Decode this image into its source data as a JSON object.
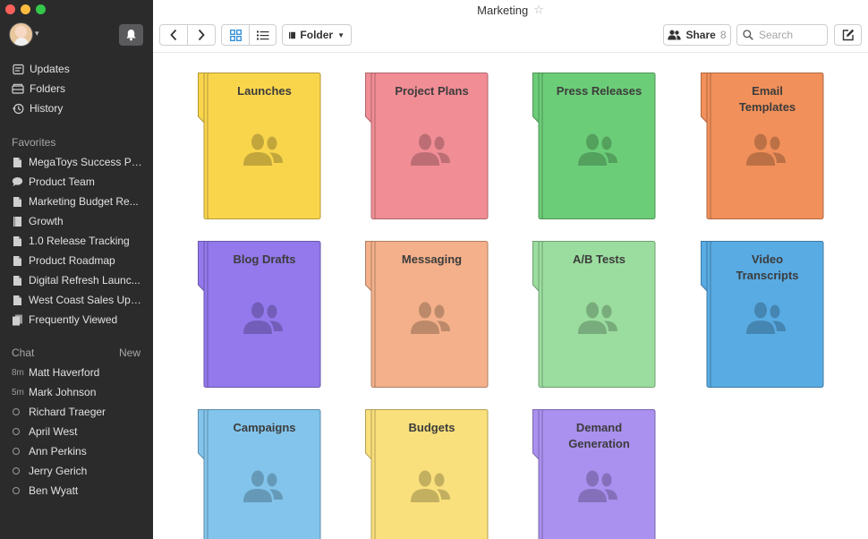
{
  "window": {
    "title": "Marketing"
  },
  "sidebar": {
    "nav": [
      {
        "label": "Updates",
        "icon": "updates-icon"
      },
      {
        "label": "Folders",
        "icon": "folders-icon"
      },
      {
        "label": "History",
        "icon": "history-icon"
      }
    ],
    "favorites_title": "Favorites",
    "favorites": [
      {
        "label": "MegaToys Success Plan",
        "icon": "document-icon"
      },
      {
        "label": "Product Team",
        "icon": "chat-bubble-icon"
      },
      {
        "label": "Marketing Budget Re...",
        "icon": "document-icon"
      },
      {
        "label": "Growth",
        "icon": "folder-icon"
      },
      {
        "label": "1.0 Release Tracking",
        "icon": "document-icon"
      },
      {
        "label": "Product Roadmap",
        "icon": "document-icon"
      },
      {
        "label": "Digital Refresh Launc...",
        "icon": "document-icon"
      },
      {
        "label": "West Coast Sales Upd...",
        "icon": "document-icon"
      },
      {
        "label": "Frequently Viewed",
        "icon": "documents-stack-icon"
      }
    ],
    "chat_title": "Chat",
    "chat_new": "New",
    "chats": [
      {
        "time": "8m",
        "name": "Matt Haverford"
      },
      {
        "time": "5m",
        "name": "Mark Johnson"
      },
      {
        "time": "",
        "name": "Richard Traeger"
      },
      {
        "time": "",
        "name": "April West"
      },
      {
        "time": "",
        "name": "Ann Perkins"
      },
      {
        "time": "",
        "name": "Jerry Gerich"
      },
      {
        "time": "",
        "name": "Ben Wyatt"
      }
    ]
  },
  "toolbar": {
    "folder_label": "Folder",
    "share_label": "Share",
    "share_count": "8",
    "search_placeholder": "Search"
  },
  "colors": {
    "accent": "#2a8bd4",
    "sidebar_bg": "#2b2b2c"
  },
  "folders": [
    {
      "label": "Launches",
      "color": "#f9d54c"
    },
    {
      "label": "Project Plans",
      "color": "#f18d95"
    },
    {
      "label": "Press Releases",
      "color": "#6ccd78"
    },
    {
      "label": "Email\nTemplates",
      "color": "#f1905a"
    },
    {
      "label": "Blog Drafts",
      "color": "#9379ec"
    },
    {
      "label": "Messaging",
      "color": "#f3b08a"
    },
    {
      "label": "A/B Tests",
      "color": "#9bdd9f"
    },
    {
      "label": "Video\nTranscripts",
      "color": "#59abe3"
    },
    {
      "label": "Campaigns",
      "color": "#82c4eb"
    },
    {
      "label": "Budgets",
      "color": "#f9e07c"
    },
    {
      "label": "Demand\nGeneration",
      "color": "#aa90ef"
    }
  ]
}
